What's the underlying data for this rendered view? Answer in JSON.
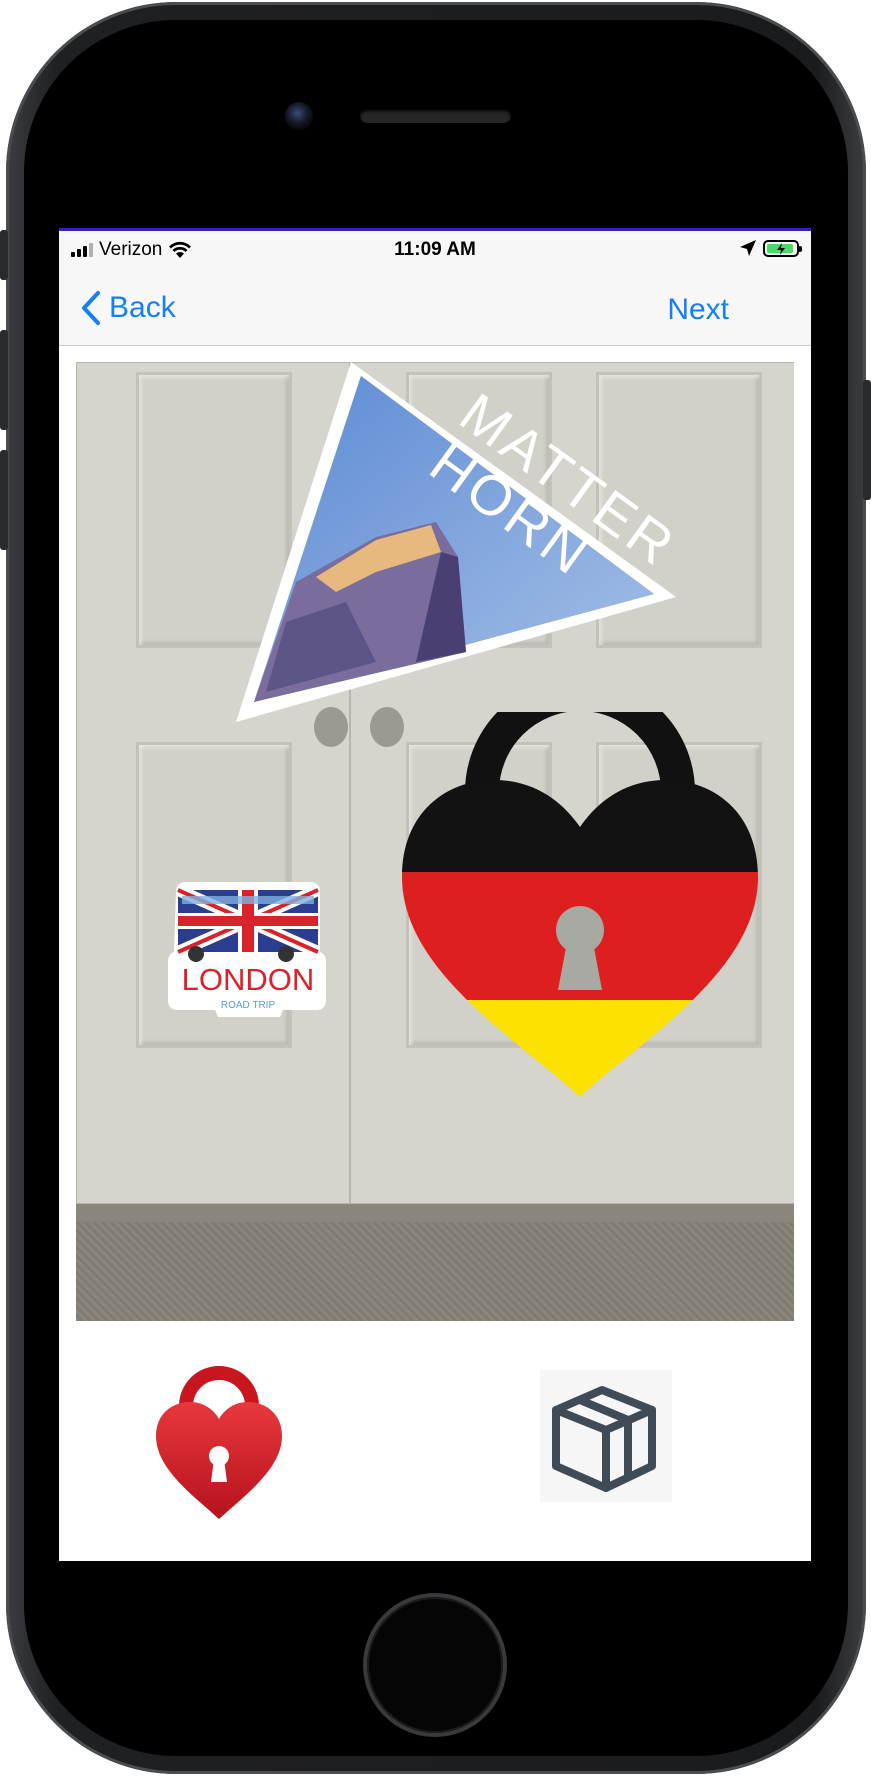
{
  "status_bar": {
    "carrier": "Verizon",
    "time": "11:09 AM"
  },
  "nav": {
    "back_label": "Back",
    "next_label": "Next"
  },
  "stickers": {
    "matterhorn_line1": "MATTER",
    "matterhorn_line2": "HORN",
    "london_title": "LONDON",
    "london_subtitle": "ROAD TRIP"
  },
  "icons": {
    "lock": "heart-lock-icon",
    "box": "cube-icon"
  },
  "colors": {
    "accent": "#147efb",
    "lock_red": "#d81f27",
    "box_slate": "#3f4c58"
  }
}
